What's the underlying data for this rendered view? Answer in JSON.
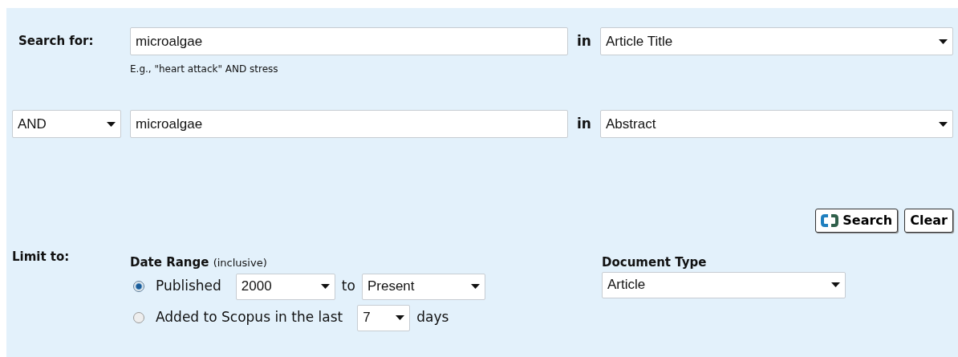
{
  "search_rows": [
    {
      "kind": "first",
      "label": "Search for:",
      "term": "microalgae",
      "in_label": "in",
      "field": "Article Title",
      "hint": "E.g., \"heart attack\" AND stress"
    },
    {
      "kind": "operator",
      "operator": "AND",
      "term": "microalgae",
      "in_label": "in",
      "field": "Abstract"
    }
  ],
  "buttons": [
    {
      "kind": "search",
      "label": "Search"
    },
    {
      "kind": "clear",
      "label": "Clear"
    }
  ],
  "limit": {
    "label": "Limit to:",
    "date_range": {
      "title": "Date Range",
      "note": "(inclusive)",
      "options": [
        {
          "kind": "published",
          "label": "Published",
          "selected": true,
          "from": "2000",
          "to_label": "to",
          "to": "Present"
        },
        {
          "kind": "added",
          "label": "Added to Scopus in the last",
          "selected": false,
          "days": "7",
          "suffix": "days"
        }
      ]
    },
    "document_type": {
      "title": "Document Type",
      "value": "Article"
    }
  }
}
